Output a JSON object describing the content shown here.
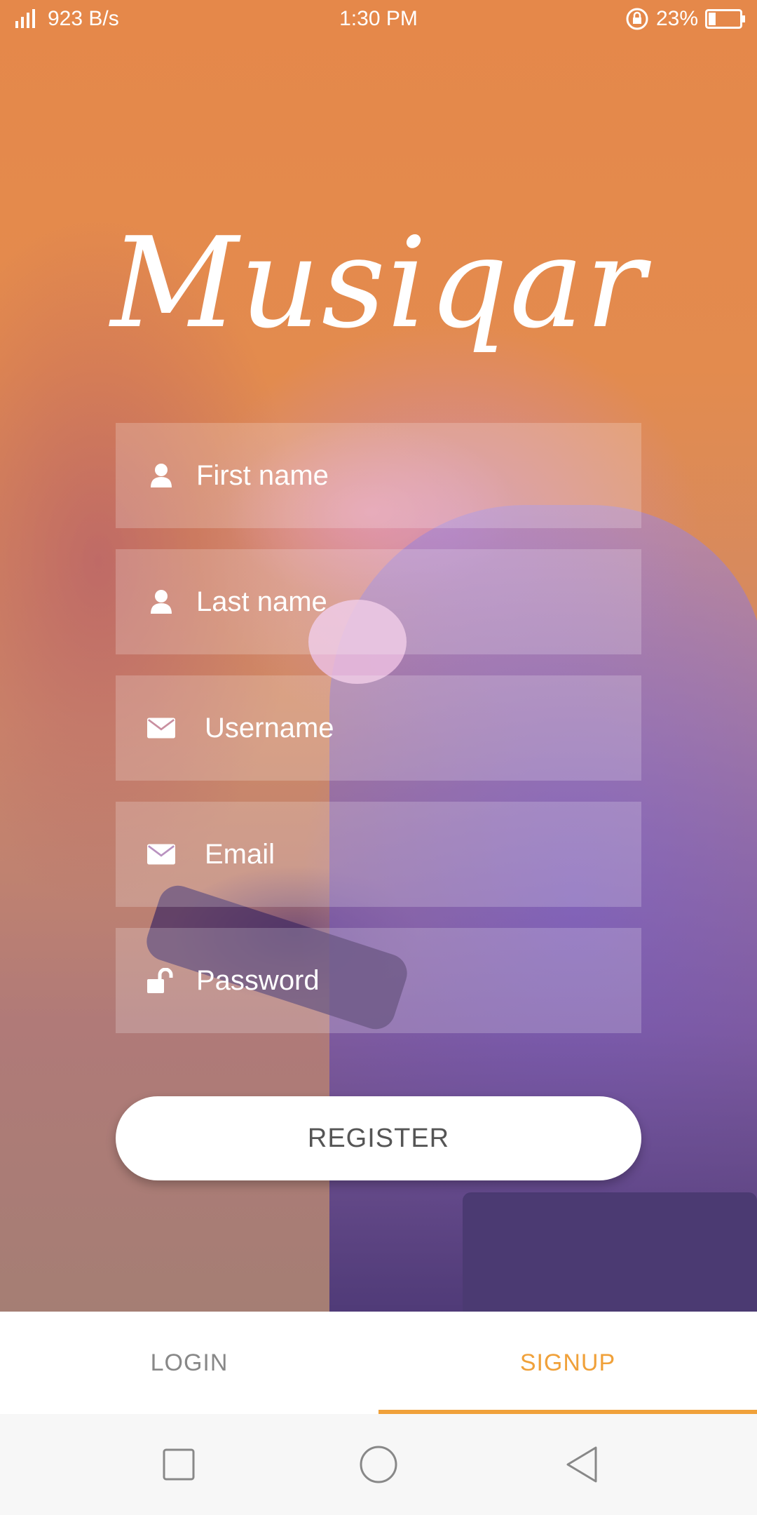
{
  "status_bar": {
    "network_speed": "923 B/s",
    "time": "1:30 PM",
    "battery": "23%",
    "battery_level": 0.23
  },
  "app": {
    "logo_text": "Musiqar"
  },
  "form": {
    "first_name": {
      "placeholder": "First name",
      "value": ""
    },
    "last_name": {
      "placeholder": "Last name",
      "value": ""
    },
    "username": {
      "placeholder": "Username",
      "value": ""
    },
    "email": {
      "placeholder": "Email",
      "value": ""
    },
    "password": {
      "placeholder": "Password",
      "value": ""
    },
    "register_label": "REGISTER"
  },
  "tabs": [
    {
      "label": "LOGIN",
      "active": false
    },
    {
      "label": "SIGNUP",
      "active": true
    }
  ],
  "colors": {
    "accent": "#f0a13a",
    "hero_top": "#e5884a",
    "tab_inactive": "#888888"
  },
  "icons": [
    "person-icon",
    "envelope-icon",
    "unlock-icon",
    "square-nav-icon",
    "circle-nav-icon",
    "triangle-back-icon"
  ]
}
